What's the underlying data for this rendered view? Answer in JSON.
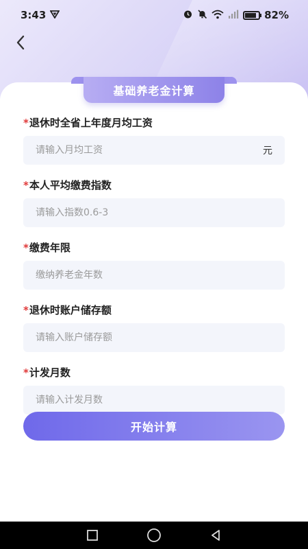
{
  "status_bar": {
    "time": "3:43",
    "battery_percent": "82%",
    "icons": [
      "vpn-icon",
      "alarm-icon",
      "mute-icon",
      "wifi-icon",
      "signal-icon",
      "battery-icon"
    ]
  },
  "header": {
    "back_icon": "back-arrow-icon",
    "title": "基础养老金计算"
  },
  "form": {
    "required_mark": "*",
    "fields": [
      {
        "label": "退休时全省上年度月均工资",
        "placeholder": "请输入月均工资",
        "value": "",
        "unit": "元"
      },
      {
        "label": "本人平均缴费指数",
        "placeholder": "请输入指数0.6-3",
        "value": ""
      },
      {
        "label": "缴费年限",
        "placeholder": "缴纳养老金年数",
        "value": ""
      },
      {
        "label": "退休时账户储存额",
        "placeholder": "请输入账户储存额",
        "value": ""
      },
      {
        "label": "计发月数",
        "placeholder": "请输入计发月数",
        "value": ""
      }
    ],
    "submit_label": "开始计算"
  },
  "nav_bar": {
    "buttons": [
      "recents-square-icon",
      "home-circle-icon",
      "back-triangle-icon"
    ]
  },
  "colors": {
    "accent": "#7a74ec",
    "required": "#e03a3a",
    "input_bg": "#f3f5fb"
  }
}
